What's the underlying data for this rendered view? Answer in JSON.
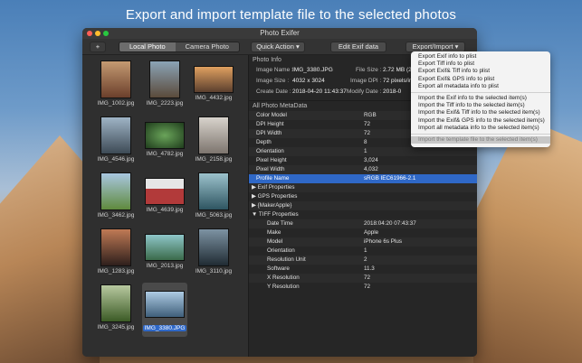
{
  "headline": "Export and import template file to the selected photos",
  "window": {
    "title": "Photo Exifer",
    "traffic_colors": [
      "#ff5f57",
      "#febc2e",
      "#28c840"
    ]
  },
  "toolbar": {
    "add_label": "+",
    "segments": [
      "Local Photo",
      "Camera Photo"
    ],
    "active_segment": "Local Photo",
    "quick_action": "Quick Action ▾",
    "edit_exif": "Edit Exif data",
    "export_import": "Export/Import ▾"
  },
  "photos": [
    {
      "name": "IMG_1002.jpg",
      "color": "#8a5a3f"
    },
    {
      "name": "IMG_2223.jpg",
      "color": "#6b7e8e"
    },
    {
      "name": "IMG_4432.jpg",
      "color": "#b86b3a"
    },
    {
      "name": "IMG_4546.jpg",
      "color": "#5b6a7a"
    },
    {
      "name": "IMG_4782.jpg",
      "color": "#3e6b3a"
    },
    {
      "name": "IMG_2158.jpg",
      "color": "#a29a93"
    },
    {
      "name": "IMG_3462.jpg",
      "color": "#6e8b4d"
    },
    {
      "name": "IMG_4639.jpg",
      "color": "#b23a3a"
    },
    {
      "name": "IMG_5063.jpg",
      "color": "#3f6b78"
    },
    {
      "name": "IMG_1283.jpg",
      "color": "#6a3f3c"
    },
    {
      "name": "IMG_2013.jpg",
      "color": "#4e8a8f"
    },
    {
      "name": "IMG_3110.jpg",
      "color": "#3c4d5a"
    },
    {
      "name": "IMG_3245.jpg",
      "color": "#5f7a3b"
    },
    {
      "name": "IMG_3380.JPG",
      "color": "#7a9bb5",
      "selected": true
    }
  ],
  "photo_info": {
    "section_title": "Photo Info",
    "image_name_label": "Image Name :",
    "image_name": "IMG_3380.JPG",
    "file_size_label": "File Size :",
    "file_size": "2.72 MB (2",
    "image_size_label": "Image Size :",
    "image_size": "4032 x 3024",
    "image_dpi_label": "Image DPI :",
    "image_dpi": "72 pixels/in",
    "create_date_label": "Create Date :",
    "create_date": "2018-04-20 11:43:37",
    "modify_date_label": "Modify Date :",
    "modify_date": "2018-0"
  },
  "metadata": {
    "section_title": "All Photo MetaData",
    "rows": [
      {
        "key": "Color Model",
        "value": "RGB",
        "type": "row"
      },
      {
        "key": "DPI Height",
        "value": "72",
        "type": "row"
      },
      {
        "key": "DPI Width",
        "value": "72",
        "type": "row"
      },
      {
        "key": "Depth",
        "value": "8",
        "type": "row"
      },
      {
        "key": "Orientation",
        "value": "1",
        "type": "row"
      },
      {
        "key": "Pixel Height",
        "value": "3,024",
        "type": "row"
      },
      {
        "key": "Pixel Width",
        "value": "4,032",
        "type": "row"
      },
      {
        "key": "Profile Name",
        "value": "sRGB IEC61966-2.1",
        "type": "row",
        "highlight": true
      },
      {
        "key": "▶ Exif Properties",
        "value": "",
        "type": "group"
      },
      {
        "key": "▶ GPS Properties",
        "value": "",
        "type": "group"
      },
      {
        "key": "▶ {MakerApple}",
        "value": "",
        "type": "group"
      },
      {
        "key": "▼ TIFF Properties",
        "value": "",
        "type": "group"
      },
      {
        "key": "Date Time",
        "value": "2018:04:20 07:43:37",
        "type": "child"
      },
      {
        "key": "Make",
        "value": "Apple",
        "type": "child"
      },
      {
        "key": "Model",
        "value": "iPhone 6s Plus",
        "type": "child"
      },
      {
        "key": "Orientation",
        "value": "1",
        "type": "child"
      },
      {
        "key": "Resolution Unit",
        "value": "2",
        "type": "child"
      },
      {
        "key": "Software",
        "value": "11.3",
        "type": "child"
      },
      {
        "key": "X Resolution",
        "value": "72",
        "type": "child"
      },
      {
        "key": "Y Resolution",
        "value": "72",
        "type": "child"
      }
    ]
  },
  "dropdown": {
    "export_items": [
      "Export Exif info to plist",
      "Export Tiff info to plist",
      "Export Exif& Tiff info to plist",
      "Export Exif& GPS info to plist",
      "Export all metadata info to plist"
    ],
    "import_items": [
      "Import the Exif info to the selected item(s)",
      "Import the Tiff info to the selected item(s)",
      "Import the Exif& Tiff info to the selected item(s)",
      "Import the Exif& GPS info to the selected item(s)",
      "Import all metadata info to the selected item(s)"
    ],
    "template_item": "Import the template file to the selected item(s)"
  }
}
